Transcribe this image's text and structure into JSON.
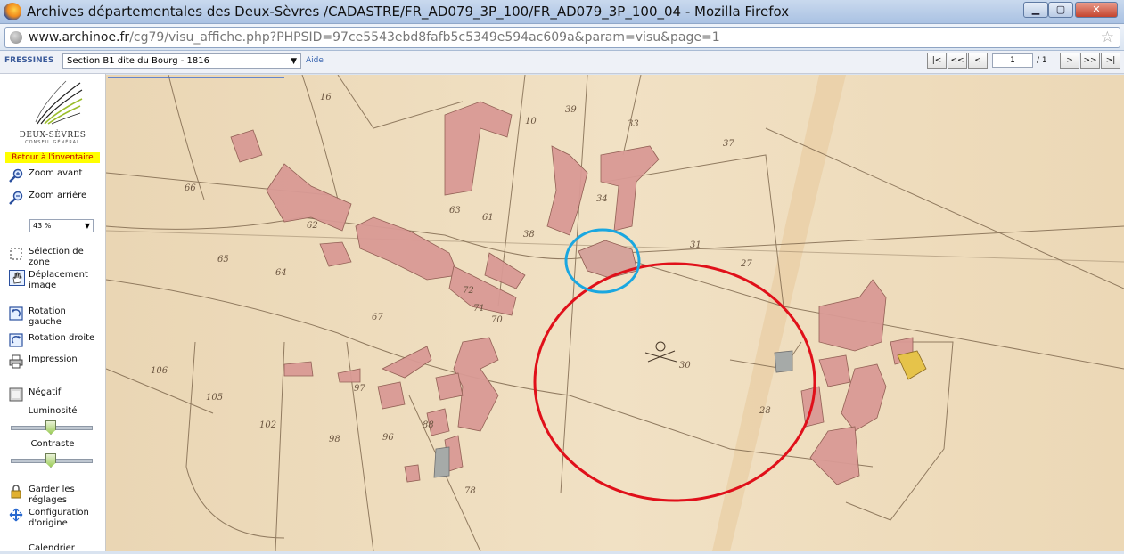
{
  "window": {
    "title": "Archives départementales des Deux-Sèvres /CADASTRE/FR_AD079_3P_100/FR_AD079_3P_100_04 - Mozilla Firefox",
    "minimize": "▁",
    "maximize": "▢",
    "close": "✕"
  },
  "address": {
    "host": "www.archinoe.fr",
    "path": "/cg79/visu_affiche.php?PHPSID=97ce5543ebd8fafb5c5349e594ac609a&param=visu&page=1"
  },
  "toolbar": {
    "commune": "FRESSINES",
    "section": "Section B1 dite du Bourg - 1816",
    "help": "Aide",
    "nav_first": "|<",
    "nav_prev_fast": "<<",
    "nav_prev": "<",
    "page": "1",
    "page_total": "/ 1",
    "nav_next": ">",
    "nav_next_fast": ">>",
    "nav_last": ">|"
  },
  "sidebar": {
    "logo_name": "DEUX-SÈVRES",
    "logo_sub": "CONSEIL GÉNÉRAL",
    "back": "Retour à l'inventaire",
    "zoom_in": "Zoom avant",
    "zoom_out": "Zoom arrière",
    "zoom_level": "43 %",
    "select_zone_1": "Sélection de",
    "select_zone_2": "zone",
    "move_1": "Déplacement",
    "move_2": "image",
    "rot_left_1": "Rotation",
    "rot_left_2": "gauche",
    "rot_right": "Rotation droite",
    "print": "Impression",
    "negative": "Négatif",
    "brightness": "Luminosité",
    "brightness_value": 0.5,
    "contrast": "Contraste",
    "contrast_value": 0.5,
    "keep_1": "Garder les",
    "keep_2": "réglages",
    "reset_1": "Configuration",
    "reset_2": "d'origine",
    "calendar": "Calendrier"
  },
  "map": {
    "parcels": [
      "16",
      "10",
      "39",
      "33",
      "37",
      "34",
      "63",
      "61",
      "66",
      "64",
      "62",
      "65",
      "67",
      "38",
      "31",
      "30",
      "106",
      "105",
      "102",
      "98",
      "97",
      "96",
      "88",
      "78",
      "28",
      "27",
      "72",
      "71",
      "70"
    ],
    "colors": {
      "paper": "#efdcbd",
      "building": "#d99a95",
      "ink": "#6b5540",
      "red_circle": "#e0101a",
      "blue_circle": "#1aa7e0",
      "highlight": "#e6c34a",
      "grey_parcel": "#a6aaa8"
    }
  }
}
